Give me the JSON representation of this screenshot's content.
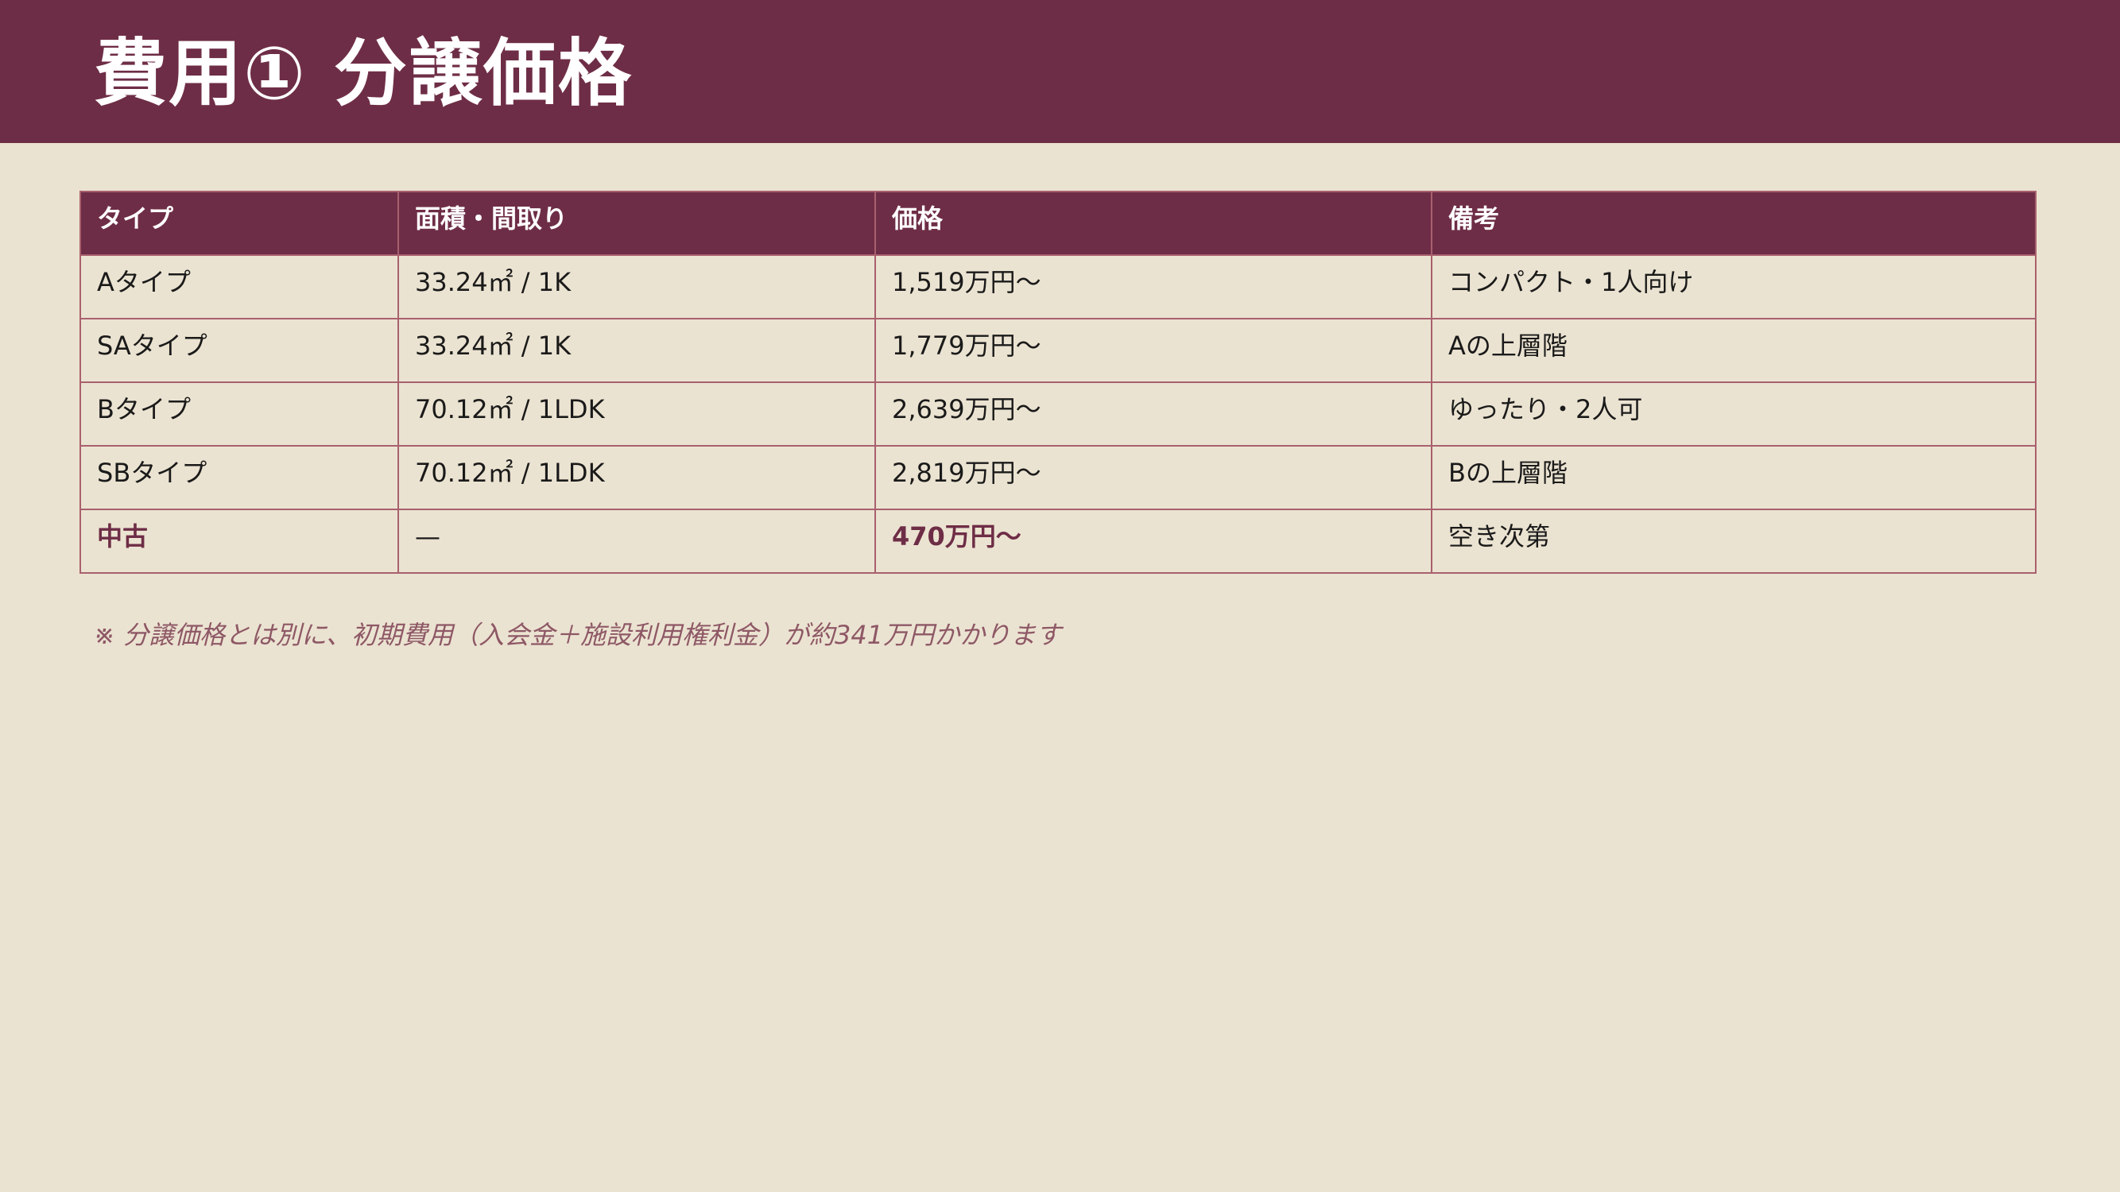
{
  "title": "費用① 分譲価格",
  "table": {
    "headers": [
      "タイプ",
      "面積・間取り",
      "価格",
      "備考"
    ],
    "rows": [
      [
        "Aタイプ",
        "33.24㎡ / 1K",
        "1,519万円〜",
        "コンパクト・1人向け"
      ],
      [
        "SAタイプ",
        "33.24㎡ / 1K",
        "1,779万円〜",
        "Aの上層階"
      ],
      [
        "Bタイプ",
        "70.12㎡ / 1LDK",
        "2,639万円〜",
        "ゆったり・2人可"
      ],
      [
        "SBタイプ",
        "70.12㎡ / 1LDK",
        "2,819万円〜",
        "Bの上層階"
      ],
      [
        "中古",
        "—",
        "470万円〜",
        "空き次第"
      ]
    ]
  },
  "note": "※ 分譲価格とは別に、初期費用（入会金＋施設利用権利金）が約341万円かかります",
  "colors": {
    "accent": "#6e2d46",
    "background": "#ebe3d1",
    "border": "#a8606e",
    "note": "#8e5866"
  }
}
